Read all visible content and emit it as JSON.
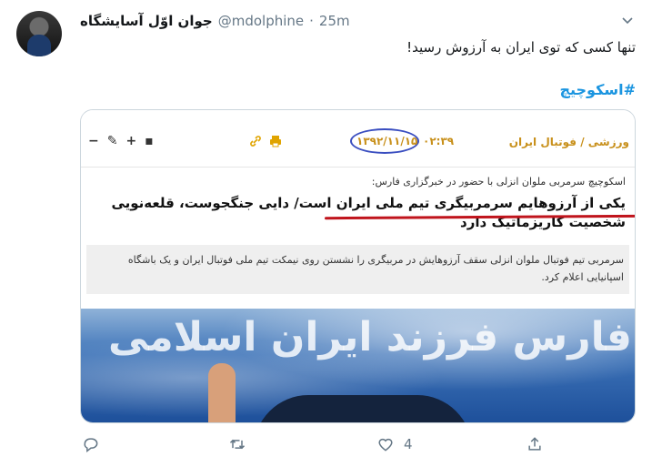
{
  "tweet": {
    "display_name": "جوان اوّل آسایشگاه",
    "handle": "@mdolphine",
    "separator": "·",
    "time": "25m",
    "text": "تنها کسی که توی ایران به آرزوش رسید!",
    "hashtag": "#اسکوچیچ"
  },
  "media": {
    "category": "ورزشی / فوتبال ایران",
    "time": "۰۲:۳۹",
    "date": "۱۳۹۲/۱۱/۱۵",
    "toolbar_icons": [
      "−",
      "✎",
      "+",
      "▪"
    ],
    "kicker": "اسکوچیچ سرمربی ملوان انزلی با حضور در خبرگزاری فارس:",
    "headline": "یکی از آرزوهایم سرمربیگری تیم ملی ایران است/ دایی جنگجوست، قلعه‌نویی شخصیت کاریزماتیک دارد",
    "lead": "سرمربی تیم فوتبال ملوان انزلی سقف آرزوهایش در مربیگری را نشستن روی نیمکت تیم ملی فوتبال ایران و یک باشگاه اسپانیایی اعلام کرد.",
    "banner_text": "فارس فرزند ایران اسلامی"
  },
  "actions": {
    "reply_count": "",
    "retweet_count": "",
    "like_count": "4"
  },
  "colors": {
    "link": "#1b95e0",
    "muted": "#657786",
    "accent_oval": "#3a4ec0",
    "underline": "#c0141c"
  }
}
